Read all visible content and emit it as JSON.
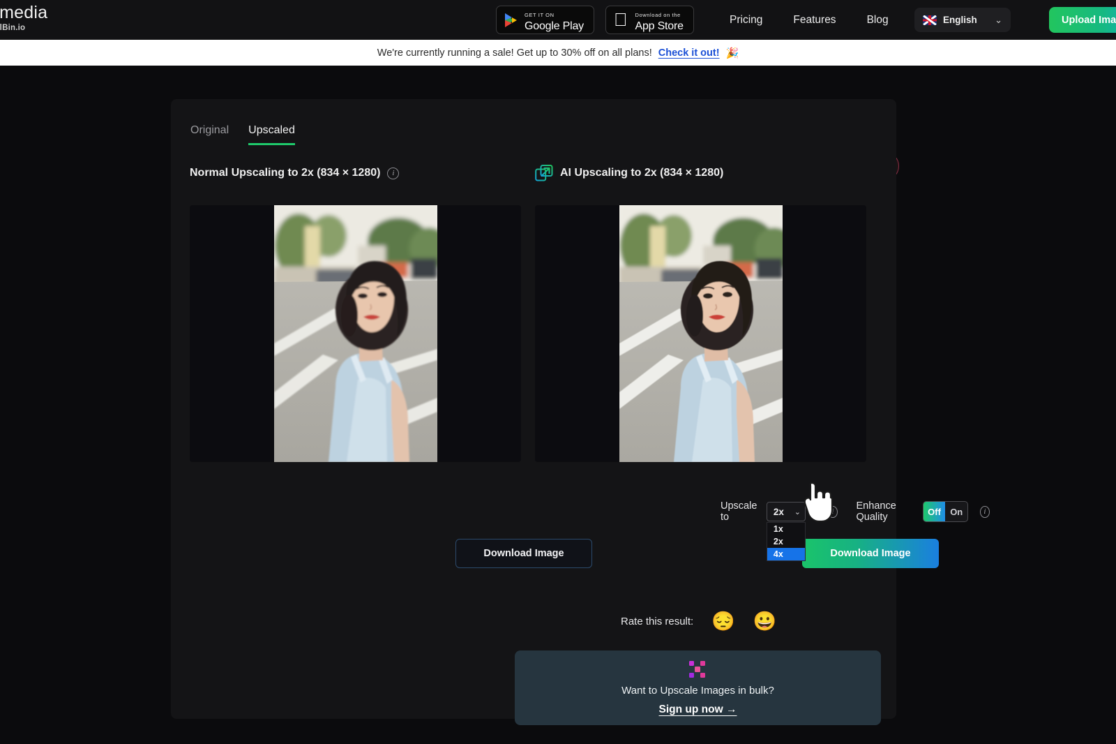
{
  "nav": {
    "logo_main": "ale.media",
    "logo_sub": "by PixelBin.io",
    "google_play_small": "GET IT ON",
    "google_play_big": "Google Play",
    "app_store_small": "Download on the",
    "app_store_big": "App Store",
    "links": [
      "Pricing",
      "Features",
      "Blog"
    ],
    "language": "English",
    "language_caret": "⌄",
    "upload_button": "Upload Imag"
  },
  "banner": {
    "text": "We're currently running a sale! Get up to 30% off on all plans!",
    "link": "Check it out!",
    "emoji": "🎉"
  },
  "modal": {
    "close_label": "×",
    "tabs": [
      {
        "label": "Original",
        "active": false
      },
      {
        "label": "Upscaled",
        "active": true
      }
    ],
    "left": {
      "title": "Normal Upscaling to 2x (834 × 1280)",
      "download_label": "Download Image"
    },
    "right": {
      "title": "AI Upscaling to 2x (834 × 1280)",
      "download_label": "Download Image"
    },
    "controls": {
      "upscale_label": "Upscale to",
      "upscale_value": "2x",
      "upscale_caret": "⌄",
      "upscale_options": [
        "1x",
        "2x",
        "4x"
      ],
      "upscale_highlighted": "4x",
      "enhance_label": "Enhance Quality",
      "enhance_off": "Off",
      "enhance_on": "On",
      "enhance_selected": "Off"
    },
    "rate": {
      "label": "Rate this result:",
      "sad_emoji": "😔",
      "happy_emoji": "😀"
    },
    "bulk": {
      "title": "Want to Upscale Images in bulk?",
      "cta": "Sign up now →"
    }
  },
  "colors": {
    "accent_green": "#1fc96b",
    "accent_blue": "#1a7fe0",
    "banner_link": "#1a4fd6",
    "close_ring": "#8c2f45",
    "bulk_card": "#26353f",
    "select_highlight": "#1673e8"
  }
}
